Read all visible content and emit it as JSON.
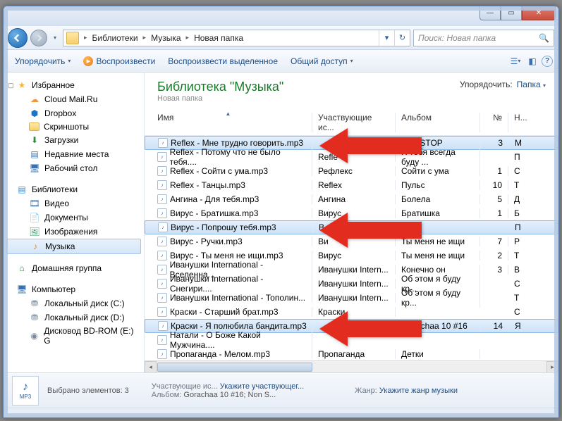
{
  "titlebar": {
    "close": "✕",
    "max": "▭",
    "min": "—"
  },
  "nav": {
    "crumbs": [
      "Библиотеки",
      "Музыка",
      "Новая папка"
    ],
    "refresh": "↻",
    "dropdown": "▾"
  },
  "search": {
    "placeholder": "Поиск: Новая папка"
  },
  "toolbar": {
    "organize": "Упорядочить",
    "play": "Воспроизвести",
    "play_selected": "Воспроизвести выделенное",
    "share": "Общий доступ"
  },
  "sidebar": {
    "favorites": {
      "label": "Избранное",
      "items": [
        {
          "label": "Cloud Mail.Ru",
          "icon": "cloud"
        },
        {
          "label": "Dropbox",
          "icon": "dropbox"
        },
        {
          "label": "Скриншоты",
          "icon": "folder"
        },
        {
          "label": "Загрузки",
          "icon": "down"
        },
        {
          "label": "Недавние места",
          "icon": "recent"
        },
        {
          "label": "Рабочий стол",
          "icon": "desk"
        }
      ]
    },
    "libraries": {
      "label": "Библиотеки",
      "items": [
        {
          "label": "Видео",
          "icon": "vid"
        },
        {
          "label": "Документы",
          "icon": "doc"
        },
        {
          "label": "Изображения",
          "icon": "img"
        },
        {
          "label": "Музыка",
          "icon": "mus",
          "selected": true
        }
      ]
    },
    "homegroup": {
      "label": "Домашняя группа"
    },
    "computer": {
      "label": "Компьютер",
      "items": [
        {
          "label": "Локальный диск (C:)",
          "icon": "disk"
        },
        {
          "label": "Локальный диск (D:)",
          "icon": "disk"
        },
        {
          "label": "Дисковод BD-ROM (E:) G",
          "icon": "bd"
        }
      ]
    }
  },
  "library": {
    "title": "Библиотека \"Музыка\"",
    "subtitle": "Новая папка",
    "arrange_label": "Упорядочить:",
    "arrange_value": "Папка"
  },
  "columns": {
    "name": "Имя",
    "artist": "Участвующие ис...",
    "album": "Альбом",
    "no": "№",
    "last": "Н..."
  },
  "files": [
    {
      "name": "Reflex - Мне трудно говорить.mp3",
      "artist": "",
      "album": "Non STOP",
      "no": "3",
      "last": "M",
      "selected": true
    },
    {
      "name": "Reflex - Потому что не было тебя....",
      "artist": "Refle",
      "album": "Я тебя всегда буду ...",
      "no": "",
      "last": "П"
    },
    {
      "name": "Reflex - Сойти с ума.mp3",
      "artist": "Рефлекс",
      "album": "Сойти с ума",
      "no": "1",
      "last": "С"
    },
    {
      "name": "Reflex - Танцы.mp3",
      "artist": "Reflex",
      "album": "Пульс",
      "no": "10",
      "last": "Т"
    },
    {
      "name": "Ангина - Для тебя.mp3",
      "artist": "Ангина",
      "album": "Болела",
      "no": "5",
      "last": "Д"
    },
    {
      "name": "Вирус - Братишка.mp3",
      "artist": "Вирус",
      "album": "Братишка",
      "no": "1",
      "last": "Б"
    },
    {
      "name": "Вирус - Попрошу тебя.mp3",
      "artist": "В",
      "album": "",
      "no": "",
      "last": "П",
      "selected": true
    },
    {
      "name": "Вирус - Ручки.mp3",
      "artist": "Ви",
      "album": "Ты меня не ищи",
      "no": "7",
      "last": "Р"
    },
    {
      "name": "Вирус - Ты меня не ищи.mp3",
      "artist": "Вирус",
      "album": "Ты меня не ищи",
      "no": "2",
      "last": "Т"
    },
    {
      "name": "Иванушки International - Вселенна...",
      "artist": "Иванушки Intern...",
      "album": "Конечно он",
      "no": "3",
      "last": "В"
    },
    {
      "name": "Иванушки International - Снегири....",
      "artist": "Иванушки Intern...",
      "album": "Об этом я буду кр...",
      "no": "",
      "last": "С"
    },
    {
      "name": "Иванушки International - Тополин...",
      "artist": "Иванушки Intern...",
      "album": "Об этом я буду кр...",
      "no": "",
      "last": "Т"
    },
    {
      "name": "Краски - Старший брат.mp3",
      "artist": "Краски",
      "album": "",
      "no": "",
      "last": "С"
    },
    {
      "name": "Краски - Я полюбила бандита.mp3",
      "artist": "",
      "album": "Gorachaa 10 #16",
      "no": "14",
      "last": "Я",
      "selected": true
    },
    {
      "name": "Натали - О Боже Какой Мужчина....",
      "artist": "",
      "album": "",
      "no": "",
      "last": ""
    },
    {
      "name": "Пропаганда - Мелом.mp3",
      "artist": "Пропаганда",
      "album": "Детки",
      "no": "",
      "last": ""
    }
  ],
  "details": {
    "selected_label": "Выбрано элементов: 3",
    "artist_label": "Участвующие ис...",
    "artist_value": "Укажите участвующег...",
    "album_label": "Альбом:",
    "album_value": "Gorachaa 10 #16; Non S...",
    "genre_label": "Жанр:",
    "genre_value": "Укажите жанр музыки",
    "thumb": "MP3"
  }
}
